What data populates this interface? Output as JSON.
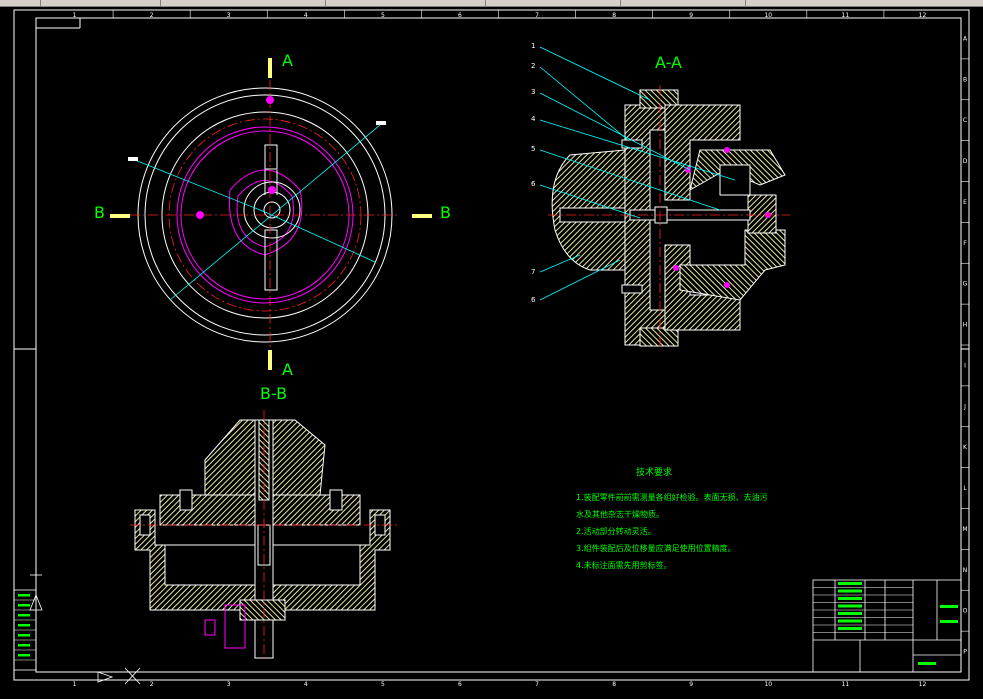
{
  "drawing": {
    "border_columns": [
      "1",
      "2",
      "3",
      "4",
      "5",
      "6",
      "7",
      "8",
      "9",
      "10",
      "11",
      "12"
    ],
    "border_rows": [
      "A",
      "B",
      "C",
      "D",
      "E",
      "F",
      "G",
      "H",
      "I",
      "J",
      "K",
      "L",
      "M",
      "N",
      "O",
      "P"
    ],
    "view_aa_title": "A-A",
    "view_bb_title": "B-B",
    "section_a": "A",
    "section_b": "B",
    "leader_numbers": [
      "1",
      "2",
      "3",
      "4",
      "5",
      "6",
      "7",
      "8",
      "6"
    ],
    "tech_req_title": "技术要求",
    "tech_req_lines": [
      "1.装配零件前前需测量各组好检验。表面无损、去油污",
      "  水及其他杂志干燥物质。",
      "2.活动部分转动灵活。",
      "3.组件装配后及位移量应满足使用位置精度。",
      "4.未标注面需先用剪标签。"
    ],
    "colors": {
      "background": "#000000",
      "outline": "#ffffff",
      "section_hatch": "#e5e5a0",
      "centerline": "#ff2020",
      "leader": "#00ffff",
      "magenta": "#ff00ff",
      "note_text": "#00ff00",
      "section_mark": "#ffff80"
    }
  }
}
